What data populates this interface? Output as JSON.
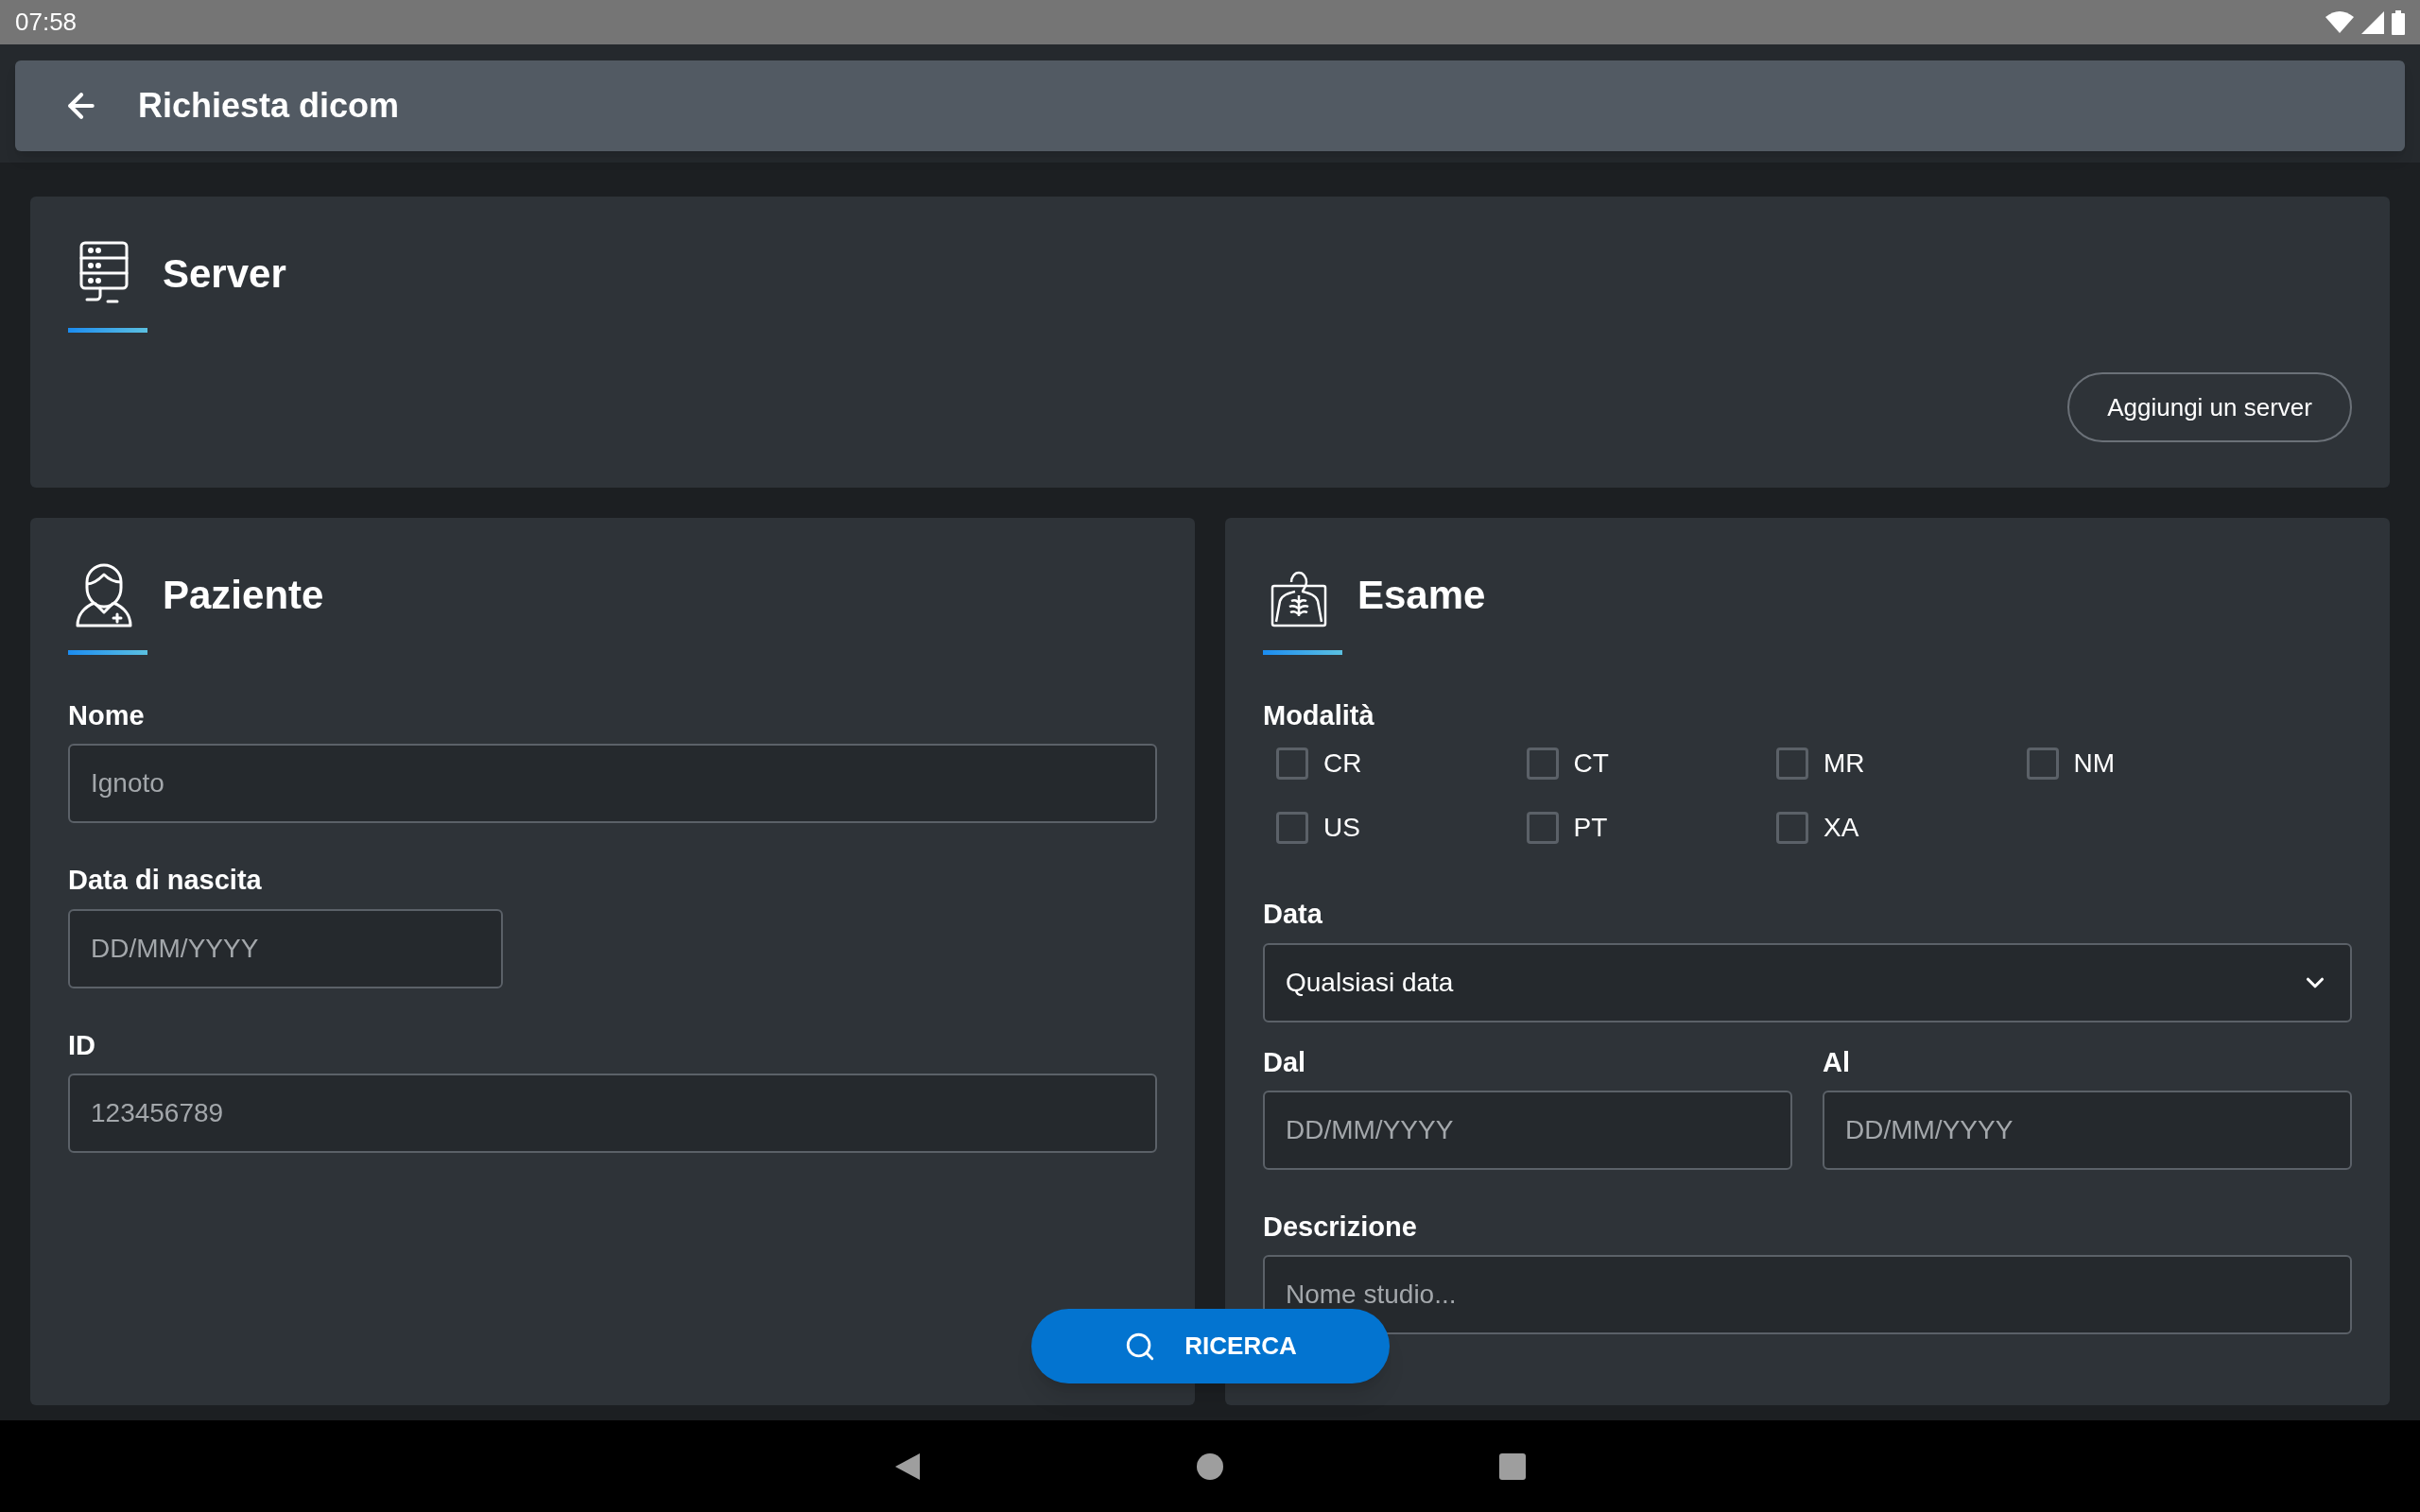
{
  "status_bar": {
    "time": "07:58"
  },
  "app_bar": {
    "title": "Richiesta dicom"
  },
  "server": {
    "title": "Server",
    "add_button": "Aggiungi un server"
  },
  "patient": {
    "title": "Paziente",
    "fields": [
      {
        "label": "Nome",
        "placeholder": "Ignoto",
        "kind": "wide"
      },
      {
        "label": "Data di nascita",
        "placeholder": "DD/MM/YYYY",
        "kind": "narrow"
      },
      {
        "label": "ID",
        "placeholder": "123456789",
        "kind": "wide"
      }
    ]
  },
  "exam": {
    "title": "Esame",
    "modality_label": "Modalità",
    "modalities": [
      {
        "label": "CR",
        "checked": false
      },
      {
        "label": "CT",
        "checked": false
      },
      {
        "label": "MR",
        "checked": false
      },
      {
        "label": "NM",
        "checked": false
      },
      {
        "label": "US",
        "checked": false
      },
      {
        "label": "PT",
        "checked": false
      },
      {
        "label": "XA",
        "checked": false
      }
    ],
    "date_label": "Data",
    "date_select": "Qualsiasi data",
    "from_label": "Dal",
    "from_placeholder": "DD/MM/YYYY",
    "to_label": "Al",
    "to_placeholder": "DD/MM/YYYY",
    "description_label": "Descrizione",
    "description_placeholder": "Nome studio..."
  },
  "search_button": "RICERCA"
}
